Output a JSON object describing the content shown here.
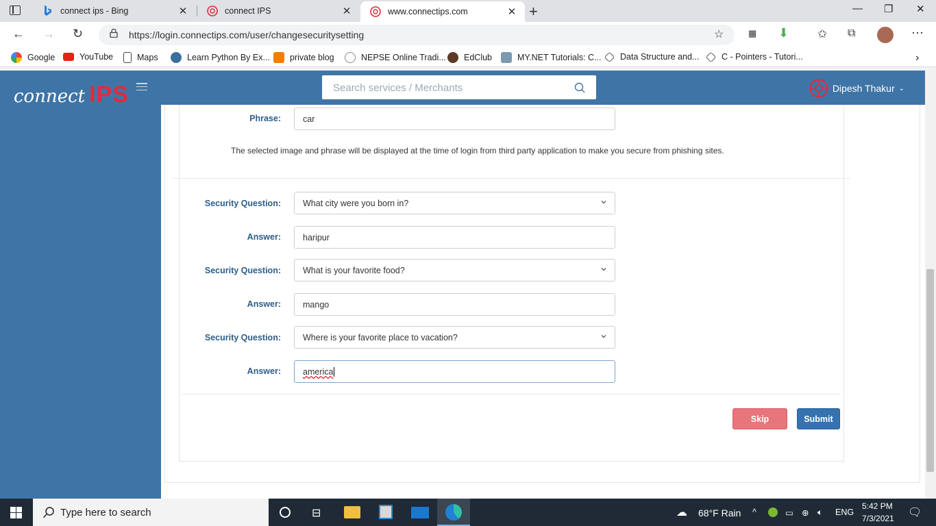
{
  "browser": {
    "tabs": [
      {
        "title": "connect ips - Bing"
      },
      {
        "title": "connect IPS"
      },
      {
        "title": "www.connectips.com"
      }
    ],
    "url": "https://login.connectips.com/user/changesecuritysetting",
    "bookmarks": [
      {
        "label": "Google"
      },
      {
        "label": "YouTube"
      },
      {
        "label": "Maps"
      },
      {
        "label": "Learn Python By Ex..."
      },
      {
        "label": "private blog"
      },
      {
        "label": "NEPSE Online Tradi..."
      },
      {
        "label": "EdClub"
      },
      {
        "label": "MY.NET Tutorials: C..."
      },
      {
        "label": "Data Structure and..."
      },
      {
        "label": "C - Pointers - Tutori..."
      }
    ]
  },
  "app": {
    "logo_text": "connect",
    "logo_brand": "IPS",
    "search_placeholder": "Search services / Merchants",
    "user_name": "Dipesh Thakur"
  },
  "form": {
    "phrase_label": "Phrase:",
    "phrase_value": "car",
    "note": "The selected image and phrase will be displayed at the time of login from third party application to make you secure from phishing sites.",
    "question_label": "Security Question:",
    "answer_label": "Answer:",
    "q1": "What city were you born in?",
    "a1": "haripur",
    "q2": "What is your favorite food?",
    "a2": "mango",
    "q3": "Where is your favorite place to vacation?",
    "a3": "america",
    "skip_label": "Skip",
    "submit_label": "Submit"
  },
  "taskbar": {
    "search_placeholder": "Type here to search",
    "weather": "68°F  Rain",
    "lang": "ENG",
    "time": "5:42 PM",
    "date": "7/3/2021"
  },
  "colors": {
    "brand_blue": "#3f75a6",
    "brand_red": "#e32b3c",
    "skip": "#e8747c",
    "submit": "#3572b0"
  }
}
